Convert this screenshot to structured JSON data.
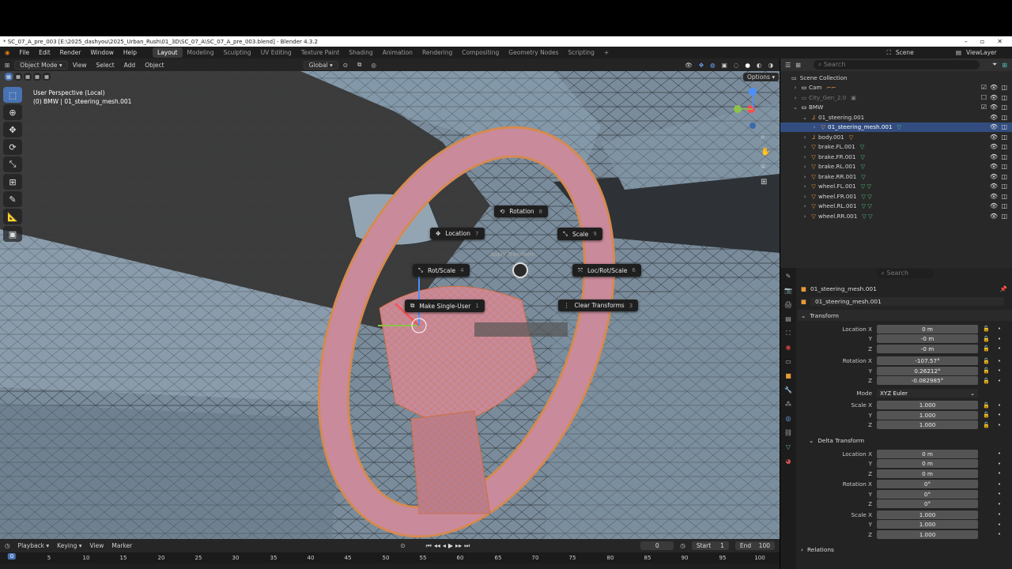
{
  "window": {
    "title": "* SC_07_A_pre_003 [E:\\2025_dashyou\\2025_Urban_Rush\\01_3D\\SC_07_A\\SC_07_A_pre_003.blend] - Blender 4.3.2"
  },
  "menu": [
    "File",
    "Edit",
    "Render",
    "Window",
    "Help"
  ],
  "workspaces": [
    "Layout",
    "Modeling",
    "Sculpting",
    "UV Editing",
    "Texture Paint",
    "Shading",
    "Animation",
    "Rendering",
    "Compositing",
    "Geometry Nodes",
    "Scripting"
  ],
  "workspace_active": "Layout",
  "topright": {
    "scene": "Scene",
    "viewlayer": "ViewLayer"
  },
  "viewport_header": {
    "mode": "Object Mode",
    "view": "View",
    "select": "Select",
    "add": "Add",
    "object": "Object",
    "orientation": "Global",
    "options": "Options"
  },
  "viewport_info": {
    "line1": "User Perspective (Local)",
    "line2": "(0) BMW | 01_steering_mesh.001"
  },
  "pie_menu": {
    "title": "Apply Transform",
    "items": [
      {
        "label": "Rotation",
        "key": "8"
      },
      {
        "label": "Location",
        "key": "7"
      },
      {
        "label": "Scale",
        "key": "9"
      },
      {
        "label": "Rot/Scale",
        "key": "4"
      },
      {
        "label": "Loc/Rot/Scale",
        "key": "6"
      },
      {
        "label": "Make Single-User",
        "key": "1"
      },
      {
        "label": "Clear Transforms",
        "key": "3"
      }
    ]
  },
  "outliner": {
    "search_placeholder": "Search",
    "rows": [
      {
        "label": "Scene Collection"
      },
      {
        "label": "Cam"
      },
      {
        "label": "City_Gen_2.0"
      },
      {
        "label": "BMW"
      },
      {
        "label": "01_steering.001"
      },
      {
        "label": "01_steering_mesh.001"
      },
      {
        "label": "body.001"
      },
      {
        "label": "brake.FL.001"
      },
      {
        "label": "brake.FR.001"
      },
      {
        "label": "brake.RL.001"
      },
      {
        "label": "brake.RR.001"
      },
      {
        "label": "wheel.FL.001"
      },
      {
        "label": "wheel.FR.001"
      },
      {
        "label": "wheel.RL.001"
      },
      {
        "label": "wheel.RR.001"
      }
    ]
  },
  "properties": {
    "search_placeholder": "Search",
    "object_name": "01_steering_mesh.001",
    "object_name2": "01_steering_mesh.001",
    "transform_label": "Transform",
    "location": {
      "label_x": "Location X",
      "x": "0 m",
      "y": "-0 m",
      "z": "-0 m"
    },
    "rotation": {
      "label_x": "Rotation X",
      "x": "-107.57°",
      "y": "0.26212°",
      "z": "-0.082985°"
    },
    "mode": {
      "label": "Mode",
      "value": "XYZ Euler"
    },
    "scale": {
      "label_x": "Scale X",
      "x": "1.000",
      "y": "1.000",
      "z": "1.000"
    },
    "delta_label": "Delta Transform",
    "dlocation": {
      "label_x": "Location X",
      "x": "0 m",
      "y": "0 m",
      "z": "0 m"
    },
    "drotation": {
      "label_x": "Rotation X",
      "x": "0°",
      "y": "0°",
      "z": "0°"
    },
    "dscale": {
      "label_x": "Scale X",
      "x": "1.000",
      "y": "1.000",
      "z": "1.000"
    },
    "relations_label": "Relations",
    "axis_y": "Y",
    "axis_z": "Z"
  },
  "timeline": {
    "playback": "Playback",
    "keying": "Keying",
    "view": "View",
    "marker": "Marker",
    "current": "0",
    "start_label": "Start",
    "start": "1",
    "end_label": "End",
    "end": "100",
    "frame_marker": "0",
    "ticks": [
      "5",
      "10",
      "15",
      "20",
      "25",
      "30",
      "35",
      "40",
      "45",
      "50",
      "55",
      "60",
      "65",
      "70",
      "75",
      "80",
      "85",
      "90",
      "95",
      "100"
    ]
  },
  "colors": {
    "accent": "#4772b3",
    "selection": "#e59a3a",
    "mesh": "#c98a9c",
    "panel": "#282828"
  }
}
